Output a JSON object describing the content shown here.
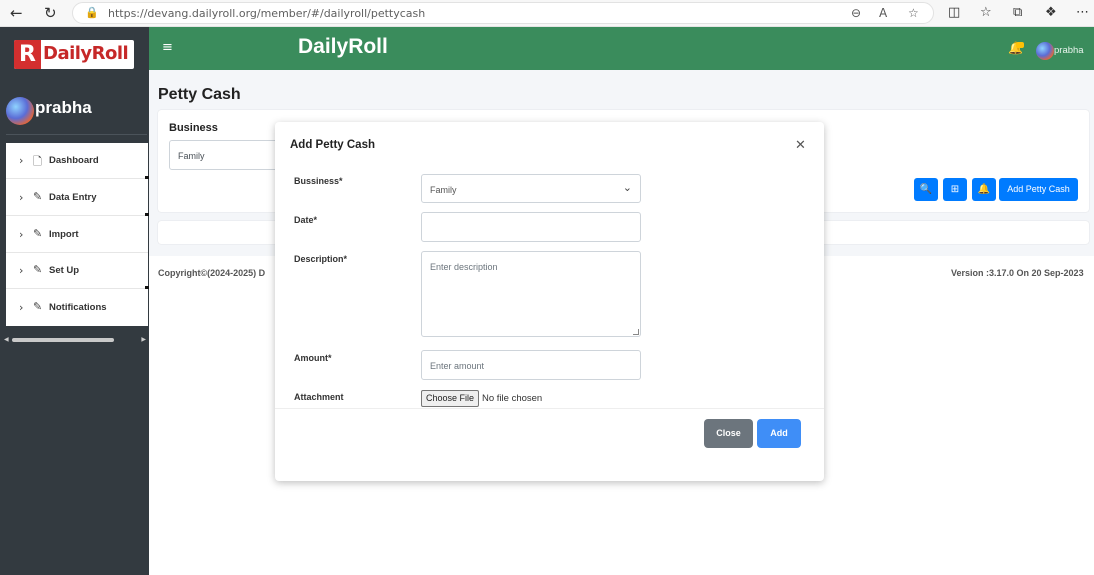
{
  "browser": {
    "url": "https://devang.dailyroll.org/member/#/dailyroll/pettycash",
    "icons": {
      "back": "back-arrow-icon",
      "reload": "reload-icon",
      "lock": "lock-icon",
      "zoom": "zoom-icon",
      "read_aloud": "read-aloud-icon",
      "favorite": "star-icon",
      "split": "split-screen-icon",
      "favorites": "favorites-icon",
      "collections": "collections-icon",
      "extensions": "extensions-icon",
      "more": "more-icon"
    }
  },
  "sidebar": {
    "logo_text": "DailyRoll",
    "logo_letter": "R",
    "user_name": "prabha",
    "menu": [
      {
        "label": "Dashboard",
        "icon": "file-icon"
      },
      {
        "label": "Data Entry",
        "icon": "pencil-icon"
      },
      {
        "label": "Import",
        "icon": "pencil-icon"
      },
      {
        "label": "Set Up",
        "icon": "pencil-icon"
      },
      {
        "label": "Notifications",
        "icon": "pencil-icon"
      }
    ]
  },
  "topbar": {
    "brand": "DailyRoll",
    "user_name": "prabha",
    "color": "#3a8c5c"
  },
  "page": {
    "title": "Petty Cash",
    "business_label": "Business",
    "business_value": "Family",
    "add_button": "Add Petty Cash",
    "copyright": "Copyright©(2024-2025) D",
    "version": "Version :3.17.0 On 20 Sep-2023"
  },
  "modal": {
    "title": "Add Petty Cash",
    "fields": {
      "business_label": "Bussiness*",
      "business_value": "Family",
      "date_label": "Date*",
      "description_label": "Description*",
      "description_placeholder": "Enter description",
      "amount_label": "Amount*",
      "amount_placeholder": "Enter amount",
      "attachment_label": "Attachment",
      "file_button": "Choose File",
      "file_status": "No file chosen"
    },
    "close_button": "Close",
    "add_button": "Add"
  }
}
